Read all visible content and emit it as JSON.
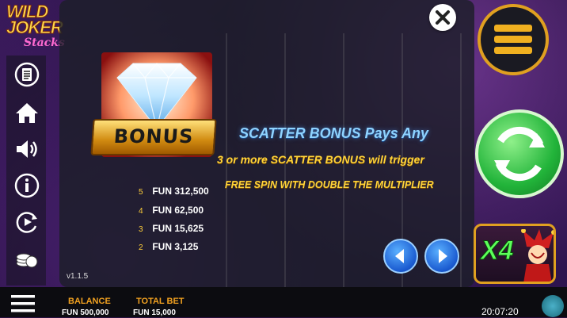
{
  "logo": {
    "line1": "WILD",
    "line2": "JOKER",
    "line3": "Stacks"
  },
  "sidebar": {
    "items": [
      {
        "icon": "paytable-icon"
      },
      {
        "icon": "home-icon"
      },
      {
        "icon": "sound-icon"
      },
      {
        "icon": "info-icon"
      },
      {
        "icon": "autoplay-icon"
      },
      {
        "icon": "coins-icon"
      }
    ]
  },
  "panel": {
    "close_icon": "close-icon",
    "bonus_badge": "BONUS",
    "description": {
      "title": "SCATTER BONUS Pays Any",
      "line2": "3 or more SCATTER BONUS will trigger",
      "line3": "FREE SPIN WITH DOUBLE THE MULTIPLIER"
    },
    "paytable": [
      {
        "count": "5",
        "amount": "FUN 312,500"
      },
      {
        "count": "4",
        "amount": "FUN 62,500"
      },
      {
        "count": "3",
        "amount": "FUN 15,625"
      },
      {
        "count": "2",
        "amount": "FUN 3,125"
      }
    ],
    "version": "v1.1.5",
    "prev_icon": "arrow-left-icon",
    "next_icon": "arrow-right-icon"
  },
  "right_panel": {
    "menu_icon": "hamburger-icon",
    "spin_icon": "spin-icon",
    "feature": {
      "multiplier": "X4"
    }
  },
  "bottom_bar": {
    "menu_icon": "hamburger-icon",
    "balance_label": "BALANCE",
    "balance_value": "FUN 500,000",
    "total_bet_label": "TOTAL BET",
    "total_bet_value": "FUN 15,000",
    "clock": "20:07:20"
  },
  "colors": {
    "accent_gold": "#e0a020",
    "scatter_title_blue": "#8fd3ff",
    "text_yellow": "#ffd43a",
    "spin_green": "#22b43a"
  }
}
